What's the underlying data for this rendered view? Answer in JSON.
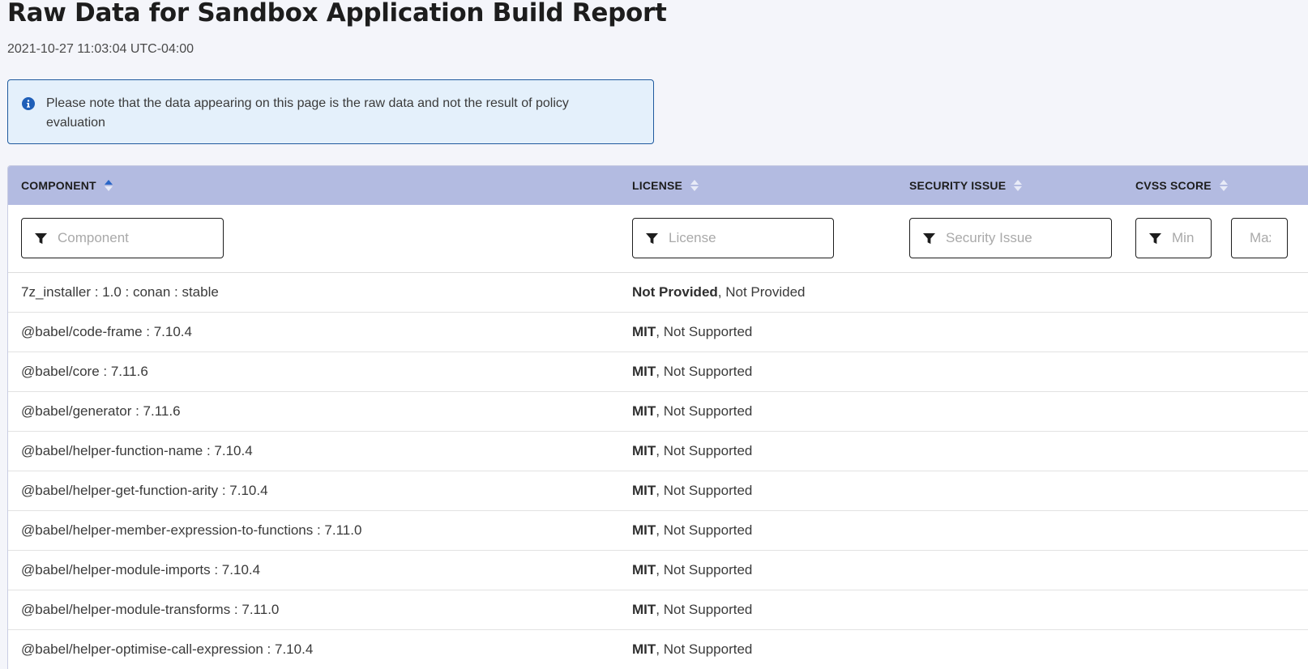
{
  "page": {
    "title": "Raw Data for Sandbox Application Build Report",
    "timestamp": "2021-10-27 11:03:04 UTC-04:00"
  },
  "notice": {
    "icon": "info-icon",
    "text": "Please note that the data appearing on this page is the raw data and not the result of policy evaluation",
    "accent_color": "#1f5a9e"
  },
  "table": {
    "header_color": "#b3bbe1",
    "columns": {
      "component": "COMPONENT",
      "license": "LICENSE",
      "security_issue": "SECURITY ISSUE",
      "cvss_score": "CVSS SCORE"
    },
    "sort": {
      "active_column": "component",
      "direction": "ascending",
      "active_color": "#2a66c7"
    },
    "filters": {
      "component_placeholder": "Component",
      "license_placeholder": "License",
      "security_issue_placeholder": "Security Issue",
      "cvss_min_placeholder": "Min",
      "cvss_max_placeholder": "Max"
    },
    "rows": [
      {
        "component": "7z_installer : 1.0 : conan : stable",
        "license_name": "Not Provided",
        "license_status": ", Not Provided"
      },
      {
        "component": "@babel/code-frame : 7.10.4",
        "license_name": "MIT",
        "license_status": ", Not Supported"
      },
      {
        "component": "@babel/core : 7.11.6",
        "license_name": "MIT",
        "license_status": ", Not Supported"
      },
      {
        "component": "@babel/generator : 7.11.6",
        "license_name": "MIT",
        "license_status": ", Not Supported"
      },
      {
        "component": "@babel/helper-function-name : 7.10.4",
        "license_name": "MIT",
        "license_status": ", Not Supported"
      },
      {
        "component": "@babel/helper-get-function-arity : 7.10.4",
        "license_name": "MIT",
        "license_status": ", Not Supported"
      },
      {
        "component": "@babel/helper-member-expression-to-functions : 7.11.0",
        "license_name": "MIT",
        "license_status": ", Not Supported"
      },
      {
        "component": "@babel/helper-module-imports : 7.10.4",
        "license_name": "MIT",
        "license_status": ", Not Supported"
      },
      {
        "component": "@babel/helper-module-transforms : 7.11.0",
        "license_name": "MIT",
        "license_status": ", Not Supported"
      },
      {
        "component": "@babel/helper-optimise-call-expression : 7.10.4",
        "license_name": "MIT",
        "license_status": ", Not Supported"
      }
    ]
  }
}
